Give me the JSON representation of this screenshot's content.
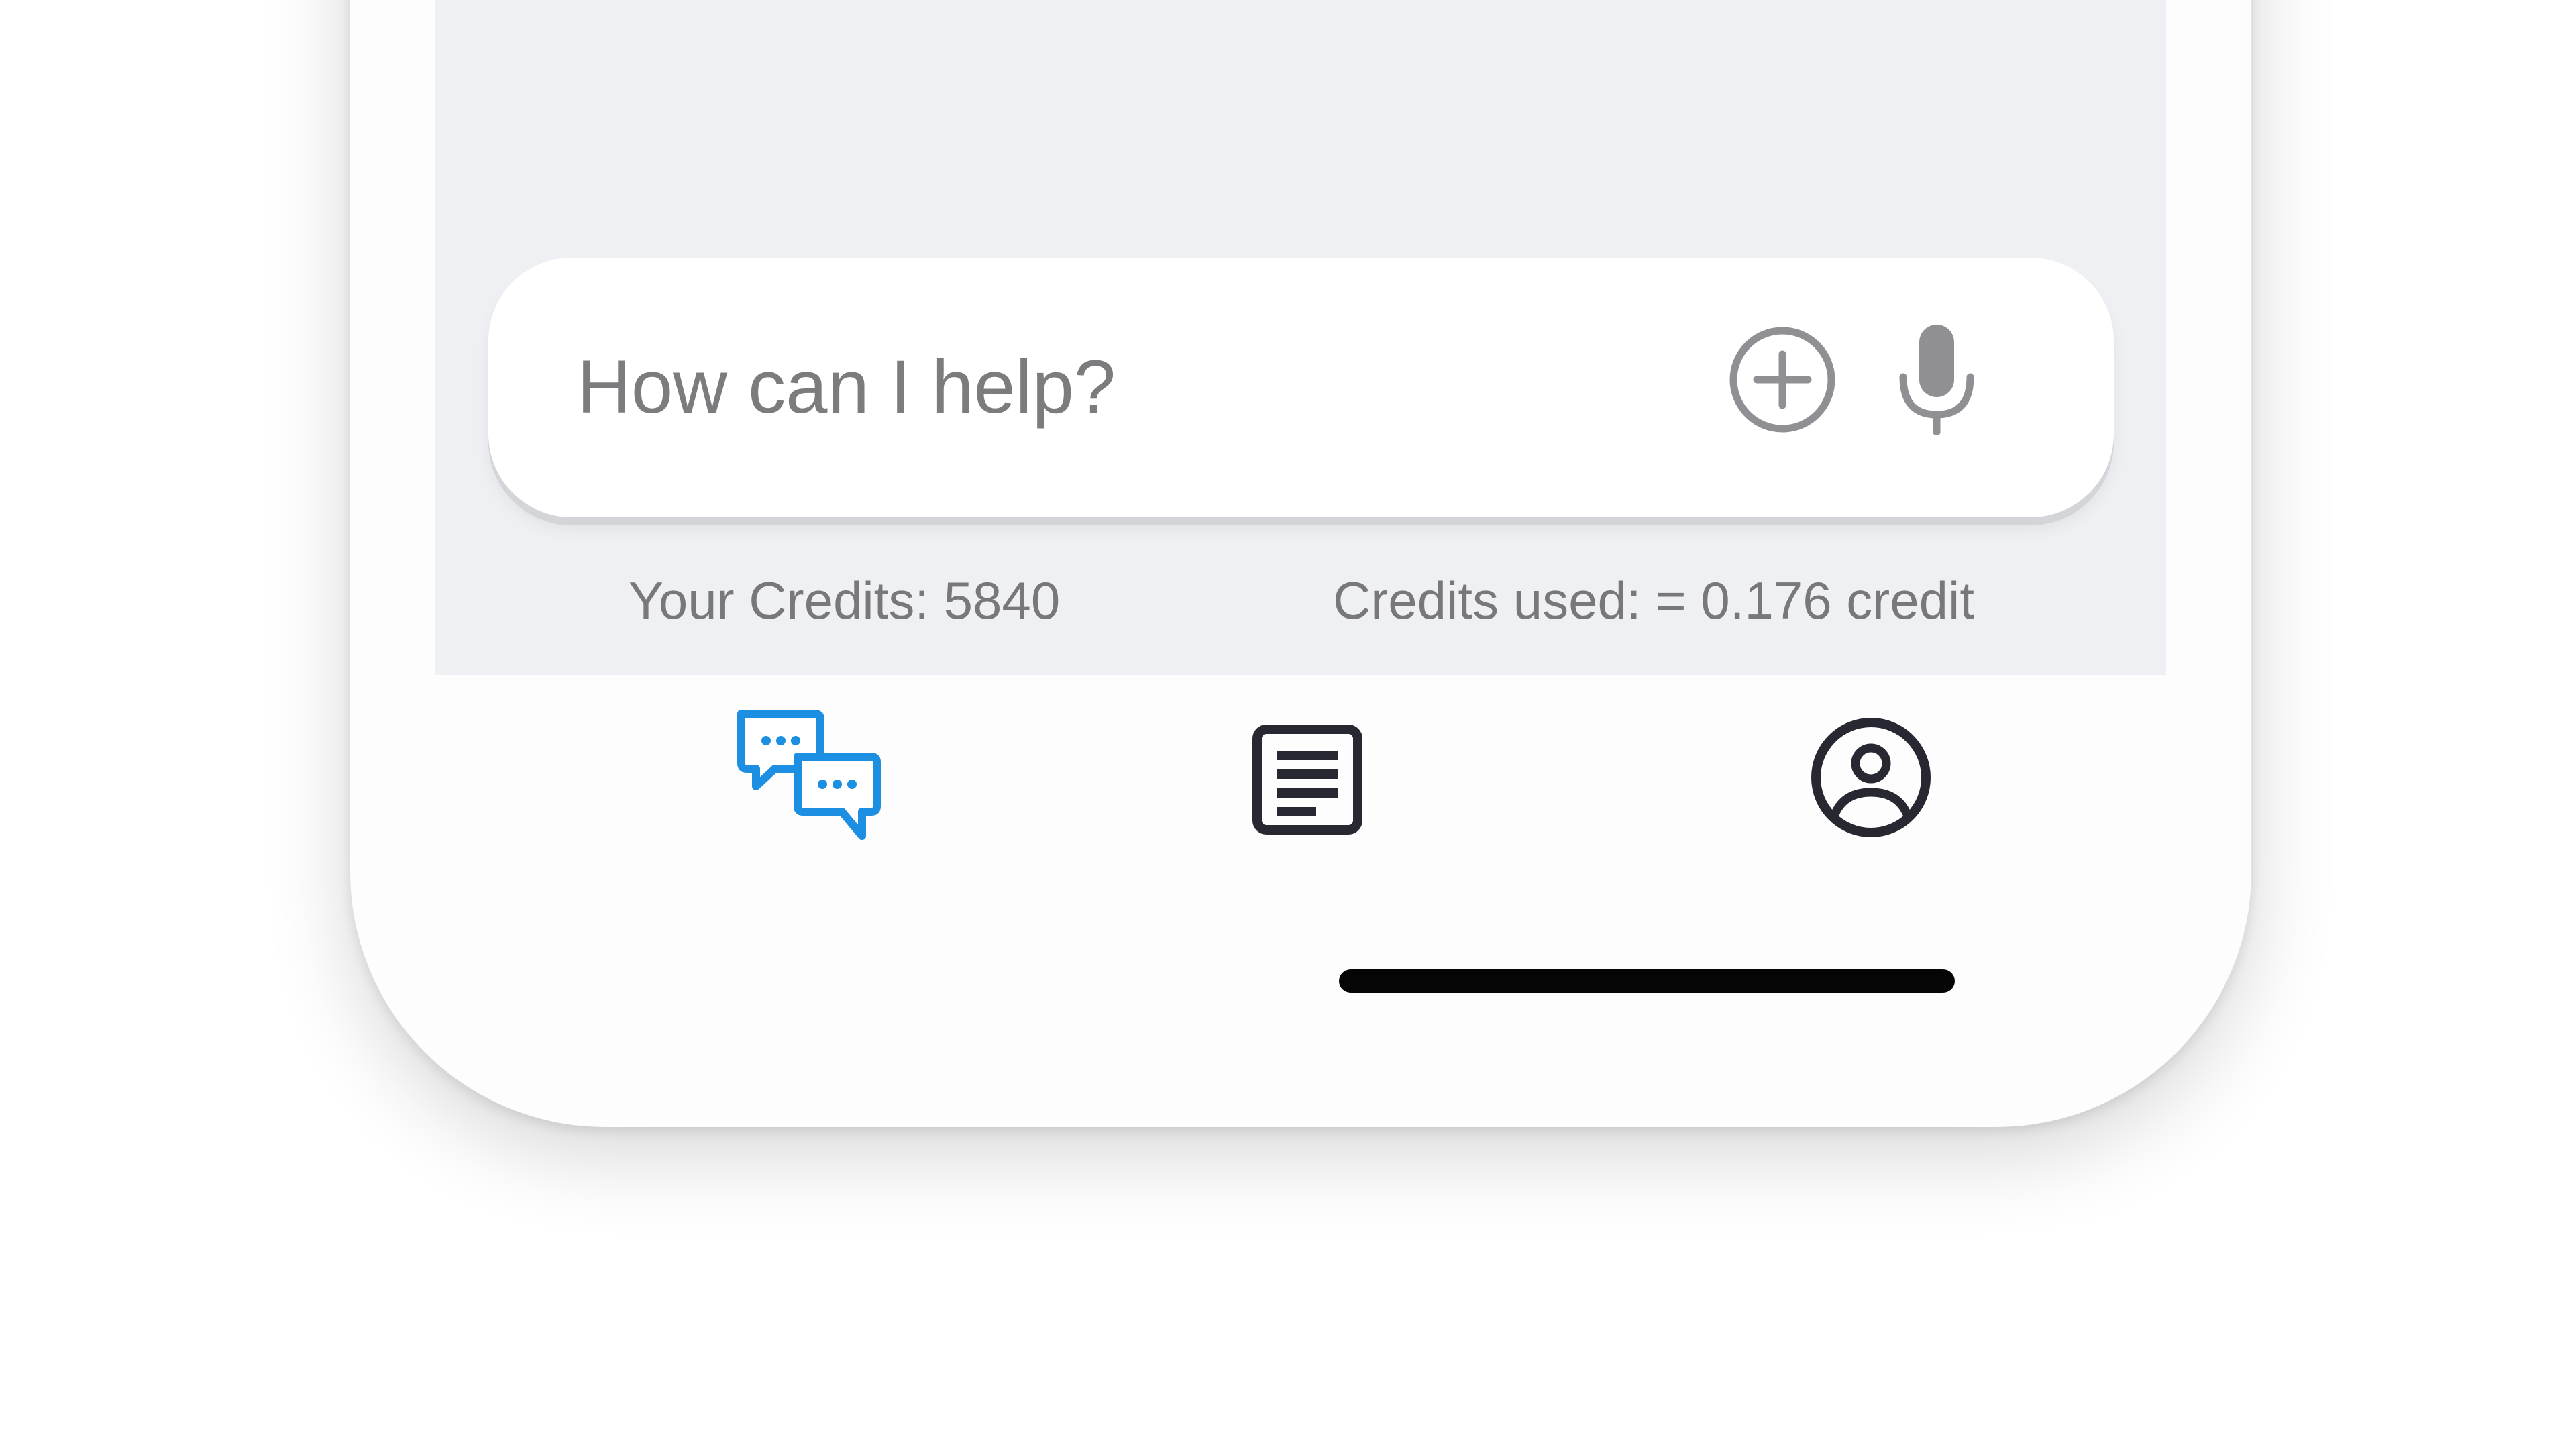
{
  "input": {
    "placeholder": "How can I help?",
    "value": ""
  },
  "icons": {
    "add": "plus-circle-icon",
    "mic": "microphone-icon",
    "chat": "chat-bubbles-icon",
    "document": "document-icon",
    "profile": "user-circle-icon"
  },
  "credits": {
    "left_text": "Your Credits: 5840",
    "right_text": "Credits used: = 0.176 credit"
  },
  "colors": {
    "accent_blue": "#1c8fe3",
    "icon_dark": "#272832",
    "icon_gray": "#909094",
    "screen_background": "#eff0f3"
  }
}
